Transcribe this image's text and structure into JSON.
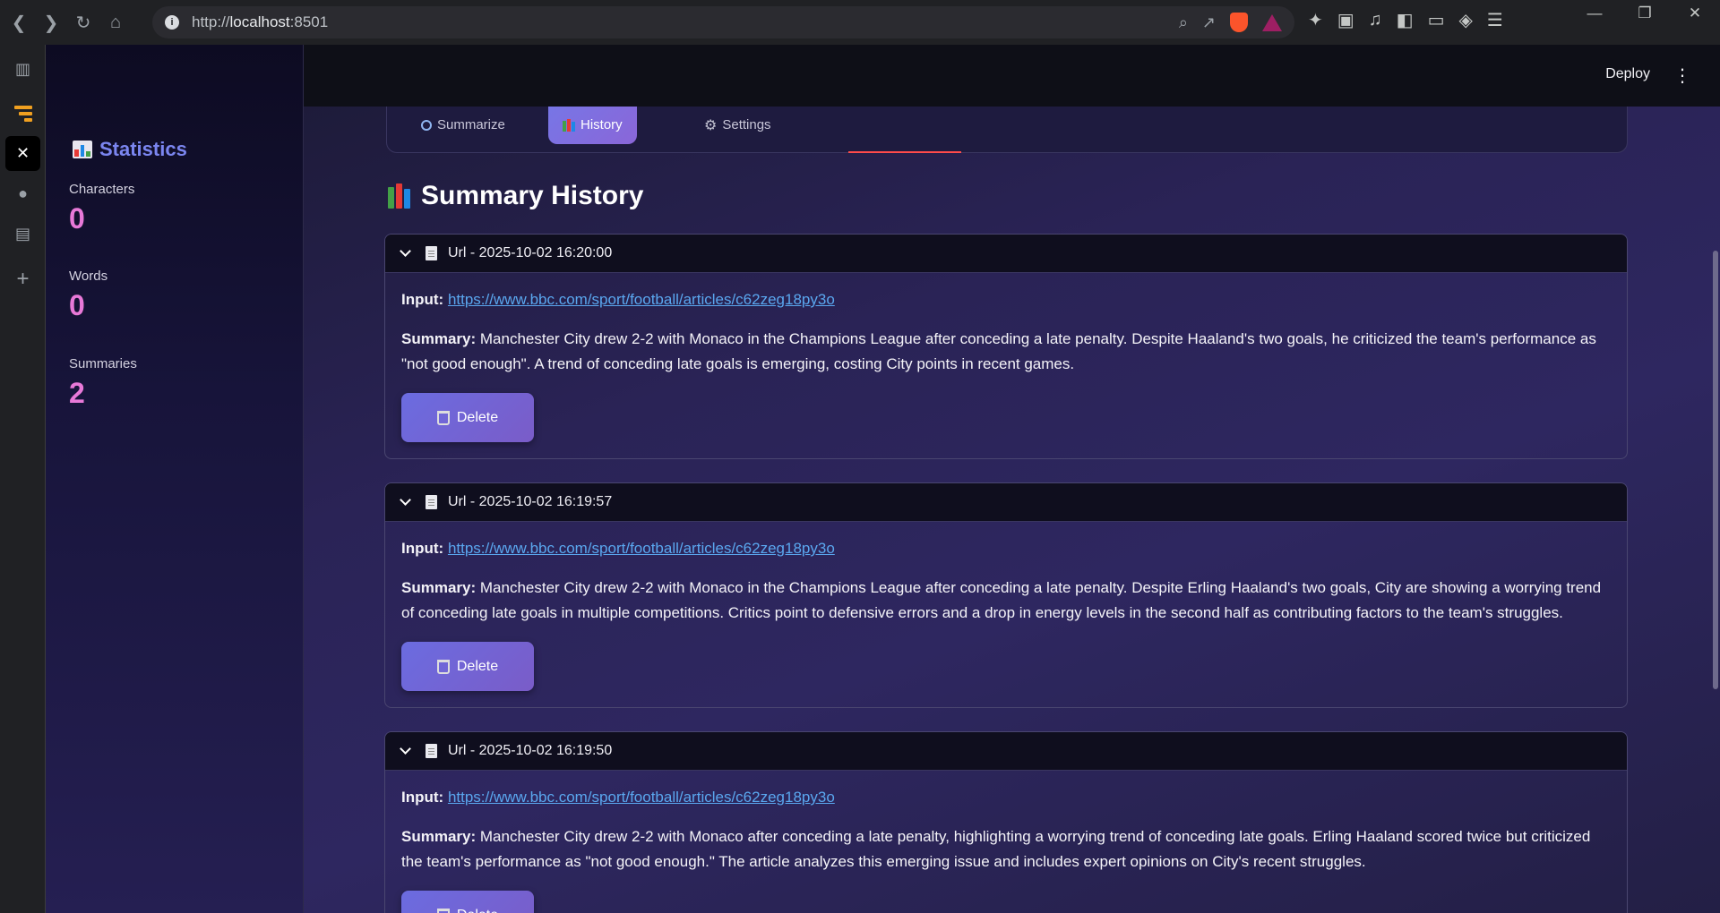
{
  "browser": {
    "url_prefix": "http://",
    "url_host": "localhost",
    "url_port": ":8501"
  },
  "app": {
    "deploy_label": "Deploy"
  },
  "sidebar": {
    "title": "Statistics",
    "metrics": [
      {
        "label": "Characters",
        "value": "0"
      },
      {
        "label": "Words",
        "value": "0"
      },
      {
        "label": "Summaries",
        "value": "2"
      }
    ]
  },
  "tabs": [
    {
      "label": "Summarize",
      "icon": "magnifier-icon"
    },
    {
      "label": "History",
      "icon": "books-icon",
      "active": true
    },
    {
      "label": "Settings",
      "icon": "gear-icon"
    }
  ],
  "history": {
    "title": "Summary History",
    "input_label": "Input:",
    "summary_label": "Summary:",
    "delete_label": "Delete",
    "entries": [
      {
        "header": "Url - 2025-10-02 16:20:00",
        "input": "https://www.bbc.com/sport/football/articles/c62zeg18py3o",
        "summary": "Manchester City drew 2-2 with Monaco in the Champions League after conceding a late penalty. Despite Haaland's two goals, he criticized the team's performance as \"not good enough\". A trend of conceding late goals is emerging, costing City points in recent games."
      },
      {
        "header": "Url - 2025-10-02 16:19:57",
        "input": "https://www.bbc.com/sport/football/articles/c62zeg18py3o",
        "summary": "Manchester City drew 2-2 with Monaco in the Champions League after conceding a late penalty. Despite Erling Haaland's two goals, City are showing a worrying trend of conceding late goals in multiple competitions. Critics point to defensive errors and a drop in energy levels in the second half as contributing factors to the team's struggles."
      },
      {
        "header": "Url - 2025-10-02 16:19:50",
        "input": "https://www.bbc.com/sport/football/articles/c62zeg18py3o",
        "summary": "Manchester City drew 2-2 with Monaco after conceding a late penalty, highlighting a worrying trend of conceding late goals. Erling Haaland scored twice but criticized the team's performance as \"not good enough.\" The article analyzes this emerging issue and includes expert opinions on City's recent struggles."
      }
    ]
  },
  "colors": {
    "accent": "#7b86f0",
    "metric_value": "#e879d8",
    "link": "#5aa7ef",
    "tab_indicator": "#ff4b4b"
  }
}
